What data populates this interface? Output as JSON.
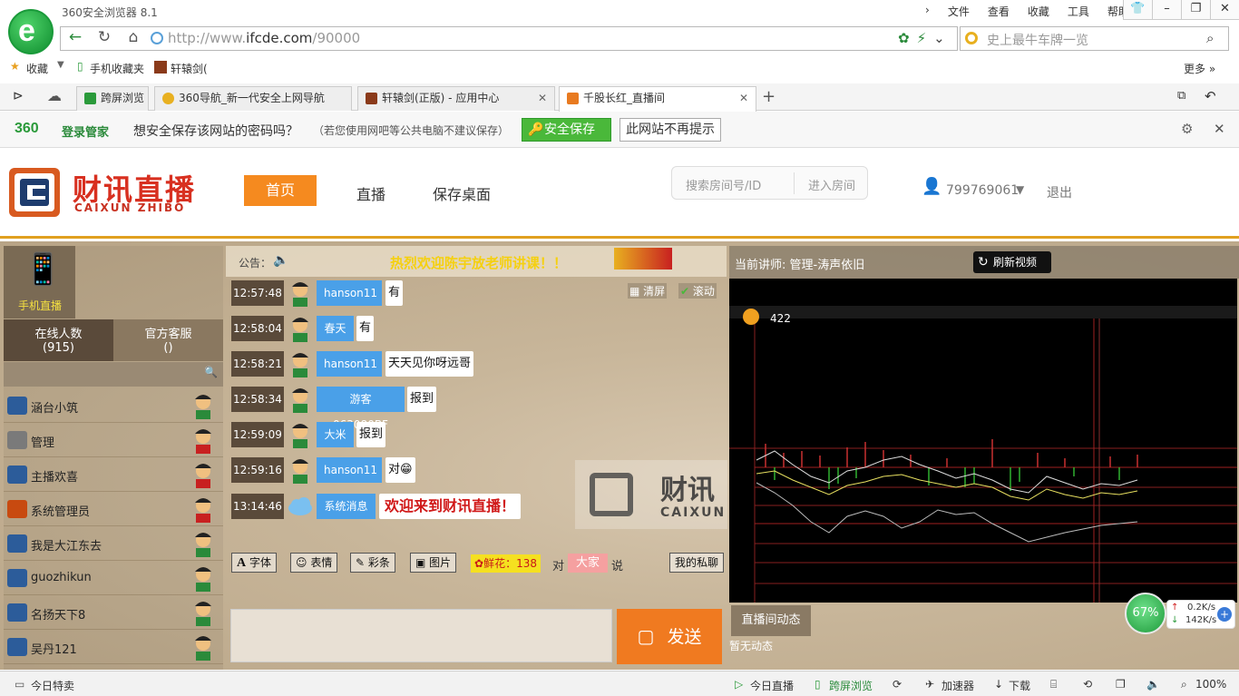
{
  "browser": {
    "app_title": "360安全浏览器 8.1",
    "menu": [
      "文件",
      "查看",
      "收藏",
      "工具",
      "帮助"
    ],
    "url_prefix": "http://www.",
    "url_domain": "ifcde.com",
    "url_suffix": "/90000",
    "search_placeholder": "史上最牛车牌一览",
    "bookmarks": {
      "favorites": "收藏",
      "mobile": "手机收藏夹",
      "game": "轩辕剑(",
      "more": "更多 »"
    },
    "tabs": [
      {
        "label": "跨屏浏览"
      },
      {
        "label": "360导航_新一代安全上网导航"
      },
      {
        "label": "轩辕剑(正版) - 应用中心"
      },
      {
        "label": "千股长红_直播间"
      }
    ],
    "new_tab": "+"
  },
  "password_bar": {
    "brand": "360",
    "brand_label": "登录管家",
    "prompt": "想安全保存该网站的密码吗？",
    "note": "（若您使用网吧等公共电脑不建议保存）",
    "save_button": "安全保存",
    "never_button": "此网站不再提示"
  },
  "site": {
    "logo_cn": "财讯直播",
    "logo_en": "CAIXUN ZHIBO",
    "nav": [
      "首页",
      "直播",
      "保存桌面"
    ],
    "search_placeholder": "搜索房间号/ID",
    "enter_room": "进入房间",
    "user_id": "799769061",
    "logout": "退出"
  },
  "left": {
    "mobile_live": "手机直播",
    "online_label": "在线人数",
    "online_count": "(915)",
    "service_label": "官方客服",
    "service_count": "()",
    "users": [
      {
        "name": "涵台小筑",
        "color": "#2c5c9a"
      },
      {
        "name": "管理",
        "color": "#7a7a7a"
      },
      {
        "name": "主播欢喜",
        "color": "#2c5c9a"
      },
      {
        "name": "系统管理员",
        "color": "#c84a10"
      },
      {
        "name": "我是大江东去",
        "color": "#2c5c9a"
      },
      {
        "name": "guozhikun",
        "color": "#2c5c9a"
      },
      {
        "name": "名扬天下8",
        "color": "#2c5c9a"
      },
      {
        "name": "吴丹121",
        "color": "#2c5c9a"
      }
    ]
  },
  "chat": {
    "announce_label": "公告：",
    "announce_text": "热烈欢迎陈宇放老师讲课！！",
    "clear": "清屏",
    "scroll": "滚动",
    "messages": [
      {
        "time": "12:57:48",
        "user": "hanson11",
        "text": "有"
      },
      {
        "time": "12:58:04",
        "user": "春天",
        "text": "有"
      },
      {
        "time": "12:58:21",
        "user": "hanson11",
        "text": "天天见你呀远哥"
      },
      {
        "time": "12:58:34",
        "user": "游客063080BF",
        "text": "报到"
      },
      {
        "time": "12:59:09",
        "user": "大米",
        "text": "报到"
      },
      {
        "time": "12:59:16",
        "user": "hanson11",
        "text": "对😁"
      },
      {
        "time": "13:14:46",
        "user": "系统消息",
        "text": "欢迎来到财讯直播！"
      }
    ],
    "toolbar": {
      "font": "字体",
      "emoji": "表情",
      "color": "彩条",
      "image": "图片",
      "flower": "鲜花：138",
      "to": "对",
      "target": "大家",
      "say": "说",
      "private": "我的私聊"
    },
    "send": "发送"
  },
  "video": {
    "teacher": "当前讲师: 管理-涛声依旧",
    "refresh": "刷新视频",
    "viewers": "422",
    "live_tab": "直播间动态",
    "no_news": "暂无动态"
  },
  "net": {
    "percent": "67%",
    "up": "0.2K/s",
    "down": "142K/s"
  },
  "statusbar": {
    "today_deals": "今日特卖",
    "today_live": "今日直播",
    "cross_screen": "跨屏浏览",
    "accelerator": "加速器",
    "download": "下载",
    "zoom": "100%"
  }
}
